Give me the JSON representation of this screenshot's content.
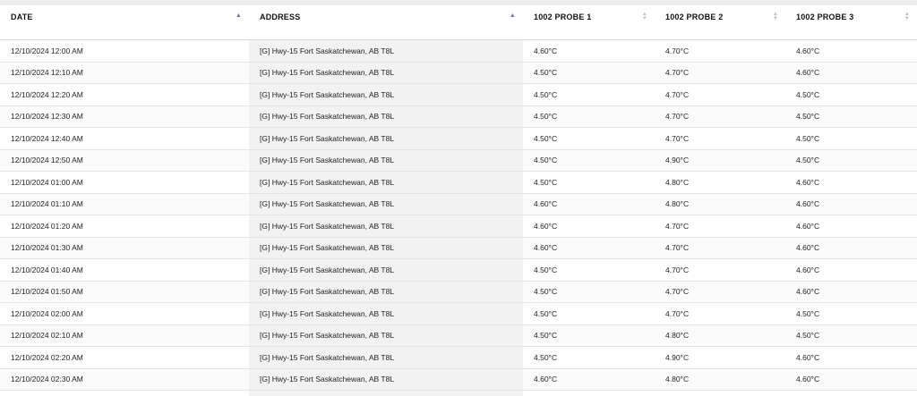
{
  "table": {
    "columns": [
      {
        "label": "DATE",
        "sort": "asc"
      },
      {
        "label": "ADDRESS",
        "sort": "asc"
      },
      {
        "label": "1002 PROBE 1",
        "sort": "none"
      },
      {
        "label": "1002 PROBE 2",
        "sort": "none"
      },
      {
        "label": "1002 PROBE 3",
        "sort": "none"
      }
    ],
    "rows": [
      {
        "date": "12/10/2024 12:00 AM",
        "address": "[G] Hwy-15 Fort Saskatchewan, AB T8L",
        "p1": "4.60°C",
        "p2": "4.70°C",
        "p3": "4.60°C"
      },
      {
        "date": "12/10/2024 12:10 AM",
        "address": "[G] Hwy-15 Fort Saskatchewan, AB T8L",
        "p1": "4.50°C",
        "p2": "4.70°C",
        "p3": "4.60°C"
      },
      {
        "date": "12/10/2024 12:20 AM",
        "address": "[G] Hwy-15 Fort Saskatchewan, AB T8L",
        "p1": "4.50°C",
        "p2": "4.70°C",
        "p3": "4.50°C"
      },
      {
        "date": "12/10/2024 12:30 AM",
        "address": "[G] Hwy-15 Fort Saskatchewan, AB T8L",
        "p1": "4.50°C",
        "p2": "4.70°C",
        "p3": "4.50°C"
      },
      {
        "date": "12/10/2024 12:40 AM",
        "address": "[G] Hwy-15 Fort Saskatchewan, AB T8L",
        "p1": "4.50°C",
        "p2": "4.70°C",
        "p3": "4.50°C"
      },
      {
        "date": "12/10/2024 12:50 AM",
        "address": "[G] Hwy-15 Fort Saskatchewan, AB T8L",
        "p1": "4.50°C",
        "p2": "4.90°C",
        "p3": "4.50°C"
      },
      {
        "date": "12/10/2024 01:00 AM",
        "address": "[G] Hwy-15 Fort Saskatchewan, AB T8L",
        "p1": "4.50°C",
        "p2": "4.80°C",
        "p3": "4.60°C"
      },
      {
        "date": "12/10/2024 01:10 AM",
        "address": "[G] Hwy-15 Fort Saskatchewan, AB T8L",
        "p1": "4.60°C",
        "p2": "4.80°C",
        "p3": "4.60°C"
      },
      {
        "date": "12/10/2024 01:20 AM",
        "address": "[G] Hwy-15 Fort Saskatchewan, AB T8L",
        "p1": "4.60°C",
        "p2": "4.70°C",
        "p3": "4.60°C"
      },
      {
        "date": "12/10/2024 01:30 AM",
        "address": "[G] Hwy-15 Fort Saskatchewan, AB T8L",
        "p1": "4.60°C",
        "p2": "4.70°C",
        "p3": "4.60°C"
      },
      {
        "date": "12/10/2024 01:40 AM",
        "address": "[G] Hwy-15 Fort Saskatchewan, AB T8L",
        "p1": "4.50°C",
        "p2": "4.70°C",
        "p3": "4.60°C"
      },
      {
        "date": "12/10/2024 01:50 AM",
        "address": "[G] Hwy-15 Fort Saskatchewan, AB T8L",
        "p1": "4.50°C",
        "p2": "4.70°C",
        "p3": "4.60°C"
      },
      {
        "date": "12/10/2024 02:00 AM",
        "address": "[G] Hwy-15 Fort Saskatchewan, AB T8L",
        "p1": "4.50°C",
        "p2": "4.70°C",
        "p3": "4.50°C"
      },
      {
        "date": "12/10/2024 02:10 AM",
        "address": "[G] Hwy-15 Fort Saskatchewan, AB T8L",
        "p1": "4.50°C",
        "p2": "4.80°C",
        "p3": "4.50°C"
      },
      {
        "date": "12/10/2024 02:20 AM",
        "address": "[G] Hwy-15 Fort Saskatchewan, AB T8L",
        "p1": "4.50°C",
        "p2": "4.90°C",
        "p3": "4.60°C"
      },
      {
        "date": "12/10/2024 02:30 AM",
        "address": "[G] Hwy-15 Fort Saskatchewan, AB T8L",
        "p1": "4.60°C",
        "p2": "4.80°C",
        "p3": "4.60°C"
      }
    ]
  },
  "colors": {
    "sort_active": "#7a6fb3",
    "sort_inactive": "#bbbbbb",
    "address_column_bg": "#f2f2f2"
  },
  "icons": {
    "sort_asc": "sort-ascending-icon",
    "sort_none": "sort-neutral-icon"
  }
}
